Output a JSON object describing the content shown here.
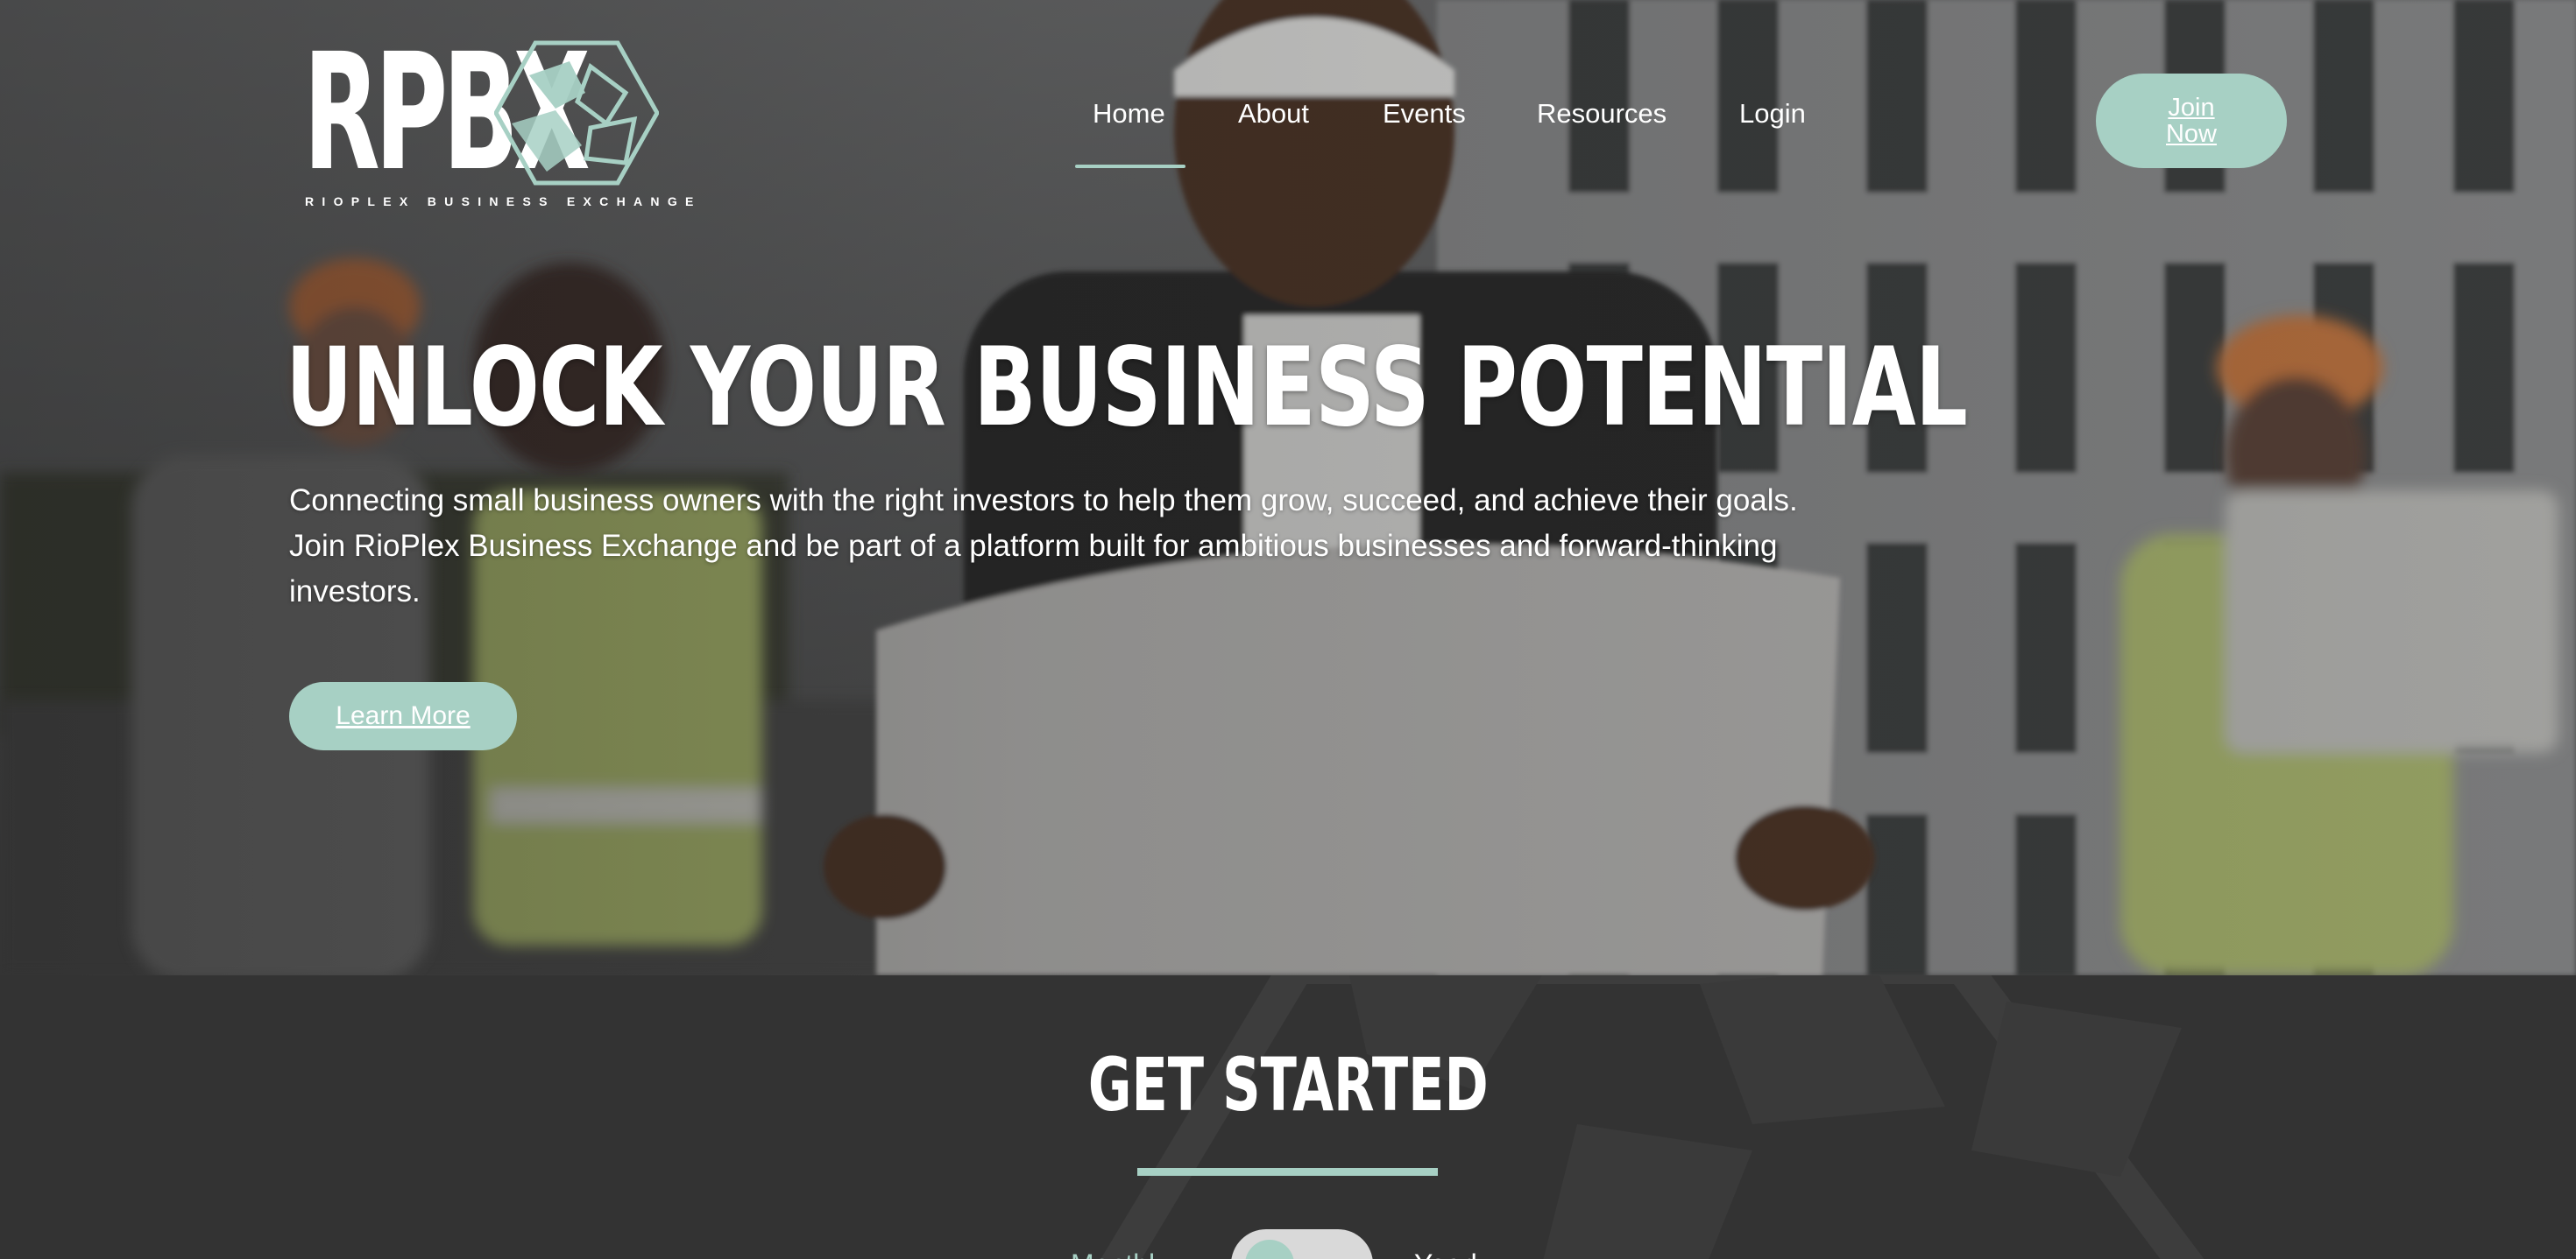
{
  "brand": {
    "logo_text": "RPBX",
    "tagline": "RIOPLEX BUSINESS EXCHANGE",
    "accent_color": "#a7d0c4"
  },
  "nav": {
    "items": [
      {
        "label": "Home",
        "active": true
      },
      {
        "label": "About"
      },
      {
        "label": "Events"
      },
      {
        "label": "Resources"
      },
      {
        "label": "Login"
      }
    ],
    "join_label": "Join Now"
  },
  "hero": {
    "title": "UNLOCK YOUR BUSINESS POTENTIAL",
    "subtitle": "Connecting small business owners with the right investors to help them grow, succeed, and achieve their goals. Join RioPlex Business Exchange and be part of a platform built for ambitious businesses and forward-thinking investors.",
    "cta_label": "Learn More"
  },
  "get_started": {
    "title": "GET STARTED",
    "toggle": {
      "left_label": "Monthly",
      "right_label": "Yearly",
      "selected": "Monthly"
    }
  }
}
